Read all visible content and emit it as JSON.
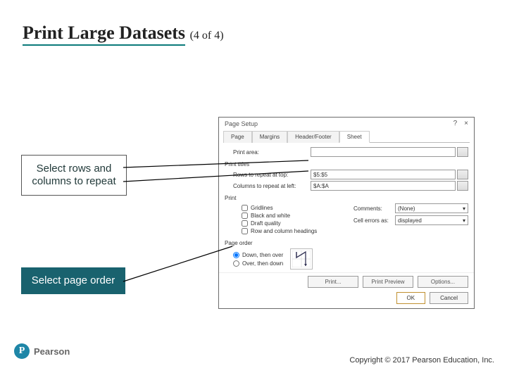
{
  "slide": {
    "title_main": "Print Large Datasets",
    "title_sub": "(4 of 4)"
  },
  "callouts": {
    "c1": "Select rows and columns to repeat",
    "c2": "Select page order"
  },
  "dialog": {
    "title": "Page Setup",
    "help_icon": "?",
    "close_icon": "×",
    "tabs": [
      "Page",
      "Margins",
      "Header/Footer",
      "Sheet"
    ],
    "active_tab_index": 3,
    "print_area": {
      "label": "Print area:",
      "value": ""
    },
    "print_titles": {
      "label": "Print titles",
      "rows_label": "Rows to repeat at top:",
      "rows_value": "$5:$5",
      "cols_label": "Columns to repeat at left:",
      "cols_value": "$A:$A"
    },
    "print_section": {
      "label": "Print",
      "gridlines": "Gridlines",
      "bw": "Black and white",
      "draft": "Draft quality",
      "headings": "Row and column headings",
      "comments_label": "Comments:",
      "comments_value": "(None)",
      "errors_label": "Cell errors as:",
      "errors_value": "displayed"
    },
    "page_order": {
      "label": "Page order",
      "r1": "Down, then over",
      "r2": "Over, then down"
    },
    "buttons": {
      "print": "Print...",
      "preview": "Print Preview",
      "options": "Options...",
      "ok": "OK",
      "cancel": "Cancel"
    }
  },
  "footer": {
    "copyright": "Copyright © 2017 Pearson Education, Inc.",
    "brand": "Pearson",
    "brand_p": "P"
  }
}
